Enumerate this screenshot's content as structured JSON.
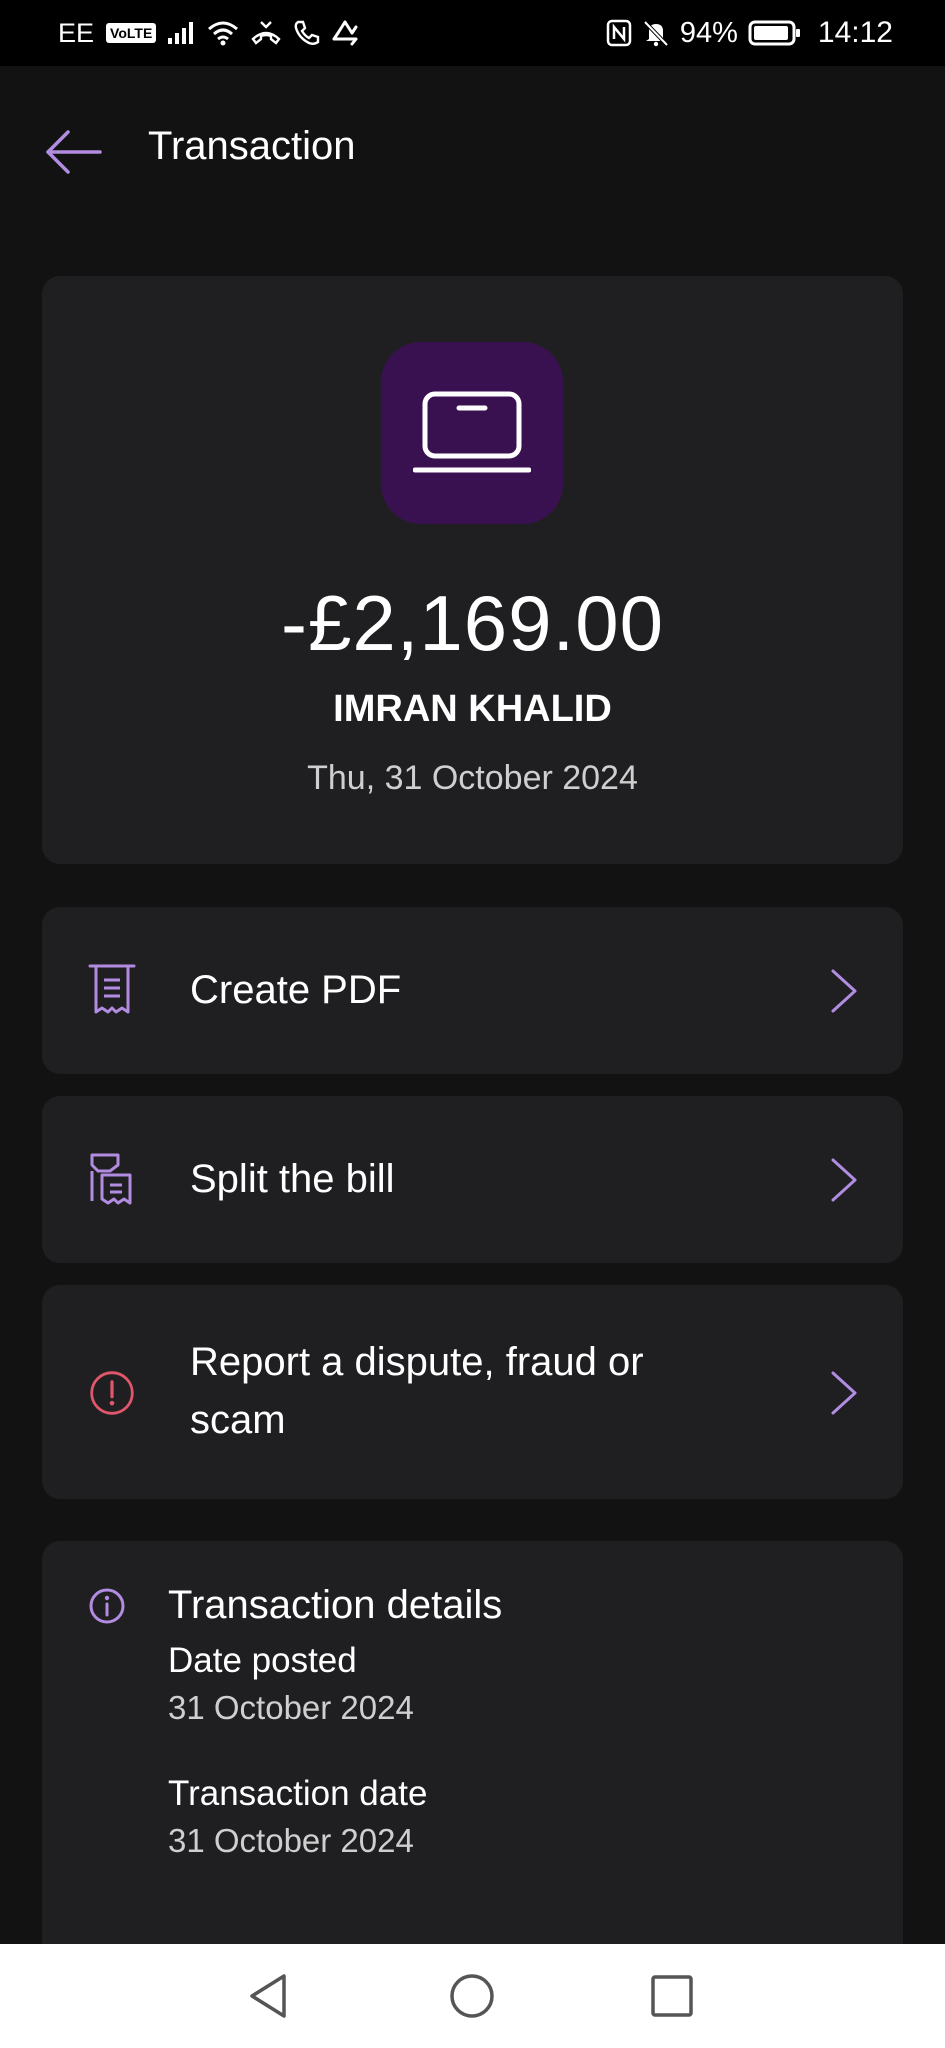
{
  "status_bar": {
    "carrier": "EE",
    "volte": "VoLTE",
    "battery": "94%",
    "time": "14:12"
  },
  "header": {
    "title": "Transaction"
  },
  "summary": {
    "icon": "laptop-icon",
    "amount": "-£2,169.00",
    "merchant": "IMRAN KHALID",
    "date": "Thu, 31 October 2024"
  },
  "actions": [
    {
      "label": "Create PDF",
      "icon": "receipt-icon"
    },
    {
      "label": "Split the bill",
      "icon": "split-bill-icon"
    },
    {
      "label": "Report a dispute, fraud or scam",
      "icon": "alert-circle-icon"
    }
  ],
  "details": {
    "title": "Transaction details",
    "items": [
      {
        "label": "Date posted",
        "value": "31 October 2024"
      },
      {
        "label": "Transaction date",
        "value": "31 October 2024"
      }
    ]
  },
  "colors": {
    "accent": "#b18ce0",
    "tile": "#3a1150",
    "card": "#1f1f21",
    "background": "#121212",
    "alert": "#e0566b"
  }
}
